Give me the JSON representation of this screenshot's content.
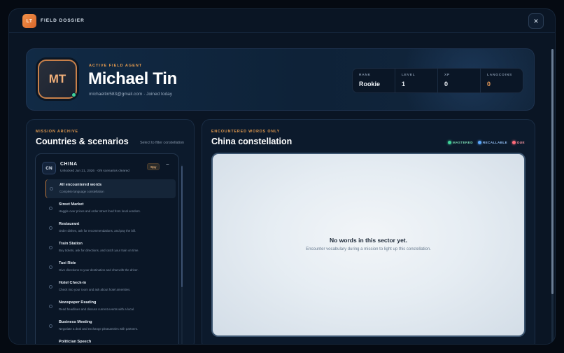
{
  "app": {
    "logo_text": "LT",
    "title": "FIELD DOSSIER",
    "close_icon": "×"
  },
  "profile": {
    "initials": "MT",
    "label": "ACTIVE FIELD AGENT",
    "name": "Michael Tin",
    "meta": "michaeltin583@gmail.com · Joined today",
    "status_color": "#3fd39a",
    "stats": [
      {
        "key": "RANK",
        "value": "Rookie"
      },
      {
        "key": "LEVEL",
        "value": "1"
      },
      {
        "key": "XP",
        "value": "0"
      },
      {
        "key": "LANGCOINS",
        "value": "0"
      }
    ]
  },
  "archive": {
    "kicker": "MISSION ARCHIVE",
    "title": "Countries & scenarios",
    "hint": "Select to filter constellation",
    "country": {
      "code": "CN",
      "name": "CHINA",
      "sub": "Unlocked Jun 21, 2026 · 0/9 scenarios cleared",
      "badge": "Spy",
      "collapse_icon": "−"
    },
    "scenarios": [
      {
        "title": "All encountered words",
        "desc": "Complete language constellation"
      },
      {
        "title": "Street Market",
        "desc": "Haggle over prices and order street food from local vendors."
      },
      {
        "title": "Restaurant",
        "desc": "Order dishes, ask for recommendations, and pay the bill."
      },
      {
        "title": "Train Station",
        "desc": "Buy tickets, ask for directions, and catch your train on time."
      },
      {
        "title": "Taxi Ride",
        "desc": "Give directions to your destination and chat with the driver."
      },
      {
        "title": "Hotel Check-in",
        "desc": "Check into your room and ask about hotel amenities."
      },
      {
        "title": "Newspaper Reading",
        "desc": "Read headlines and discuss current events with a local."
      },
      {
        "title": "Business Meeting",
        "desc": "Negotiate a deal and exchange pleasantries with partners."
      },
      {
        "title": "Politician Speech",
        "desc": ""
      }
    ]
  },
  "constellation": {
    "kicker": "ENCOUNTERED WORDS ONLY",
    "title": "China constellation",
    "legend": [
      {
        "label": "MASTERED",
        "color": "#3fd39a"
      },
      {
        "label": "RECALLABLE",
        "color": "#5aa8ff"
      },
      {
        "label": "DUE",
        "color": "#ff6b7a"
      }
    ],
    "empty_title": "No words in this sector yet.",
    "empty_sub": "Encounter vocabulary during a mission to light up this constellation."
  }
}
